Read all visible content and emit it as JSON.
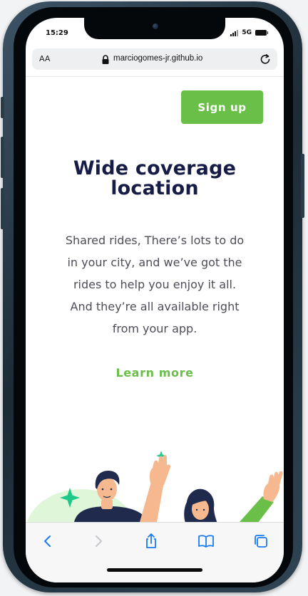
{
  "status_bar": {
    "time": "15:29",
    "network": "5G"
  },
  "browser": {
    "text_size_label": "AA",
    "url": "marciogomes-jr.github.io"
  },
  "page": {
    "signup_label": "Sign up",
    "headline_line1": "Wide coverage",
    "headline_line2": "location",
    "body_lines": [
      "Shared rides, There’s lots to do",
      "in your city, and we’ve got the",
      "rides to help you enjoy it all.",
      "And they’re all available right",
      "from your app."
    ],
    "learn_more_label": "Learn more"
  },
  "toolbar_icons": [
    "back-icon",
    "forward-icon",
    "share-icon",
    "bookmarks-icon",
    "tabs-icon"
  ],
  "colors": {
    "accent_green": "#6abf48",
    "headline_navy": "#161c45",
    "body_gray": "#4d4d57",
    "toolbar_blue": "#1a7cf0"
  }
}
